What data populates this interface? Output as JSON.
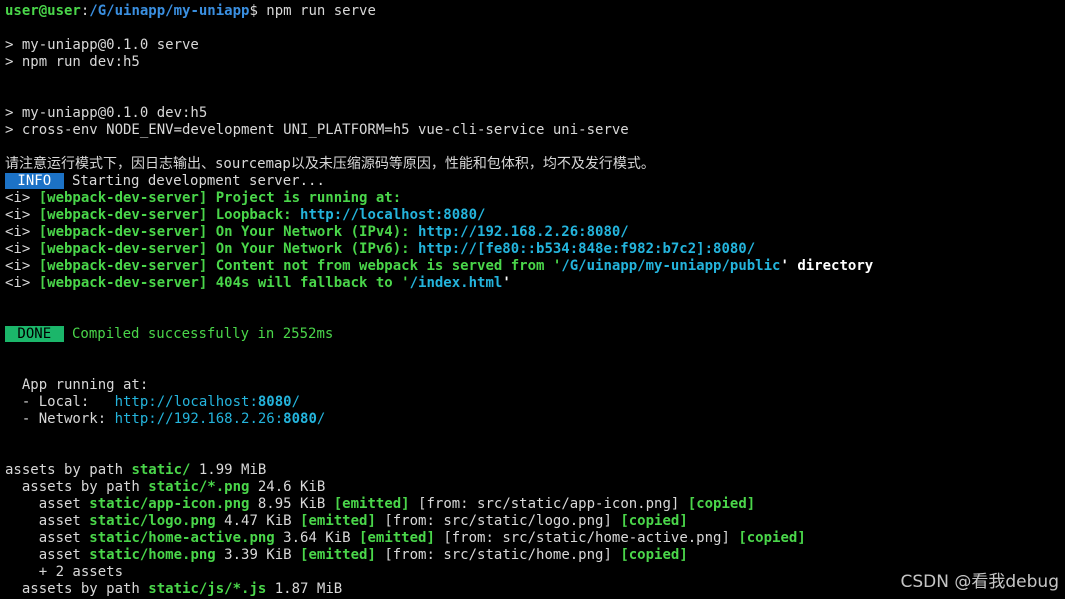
{
  "terminal": {
    "lines": [
      [
        {
          "t": "user@user",
          "c": "gb"
        },
        {
          "t": ":",
          "c": "w"
        },
        {
          "t": "/G/uinapp/my-uniapp",
          "c": "bb"
        },
        {
          "t": "$ npm run serve",
          "c": "w"
        }
      ],
      [],
      [
        {
          "t": "> my-uniapp@0.1.0 serve",
          "c": "w"
        }
      ],
      [
        {
          "t": "> npm run dev:h5",
          "c": "w"
        }
      ],
      [],
      [],
      [
        {
          "t": "> my-uniapp@0.1.0 dev:h5",
          "c": "w"
        }
      ],
      [
        {
          "t": "> cross-env NODE_ENV=development UNI_PLATFORM=h5 vue-cli-service uni-serve",
          "c": "w"
        }
      ],
      [],
      [
        {
          "t": "请注意运行模式下，因日志输出、sourcemap以及未压缩源码等原因，性能和包体积，均不及发行模式。",
          "c": "w"
        }
      ],
      [
        {
          "t": " INFO ",
          "c": "badge-info"
        },
        {
          "t": " Starting development server...",
          "c": "w"
        }
      ],
      [
        {
          "t": "<i> ",
          "c": "w"
        },
        {
          "t": "[webpack-dev-server] Project is running at:",
          "c": "gb"
        }
      ],
      [
        {
          "t": "<i> ",
          "c": "w"
        },
        {
          "t": "[webpack-dev-server] Loopback: ",
          "c": "gb"
        },
        {
          "t": "http://localhost:8080/",
          "c": "cb"
        }
      ],
      [
        {
          "t": "<i> ",
          "c": "w"
        },
        {
          "t": "[webpack-dev-server] On Your Network (IPv4): ",
          "c": "gb"
        },
        {
          "t": "http://192.168.2.26:8080/",
          "c": "cb"
        }
      ],
      [
        {
          "t": "<i> ",
          "c": "w"
        },
        {
          "t": "[webpack-dev-server] On Your Network (IPv6): ",
          "c": "gb"
        },
        {
          "t": "http://[fe80::b534:848e:f982:b7c2]:8080/",
          "c": "cb"
        }
      ],
      [
        {
          "t": "<i> ",
          "c": "w"
        },
        {
          "t": "[webpack-dev-server] Content not from webpack is served from '",
          "c": "gb"
        },
        {
          "t": "/G/uinapp/my-uniapp/public",
          "c": "cb"
        },
        {
          "t": "' directory",
          "c": "wb"
        }
      ],
      [
        {
          "t": "<i> ",
          "c": "w"
        },
        {
          "t": "[webpack-dev-server] 404s will fallback to '",
          "c": "gb"
        },
        {
          "t": "/index.html",
          "c": "cb"
        },
        {
          "t": "'",
          "c": "wb"
        }
      ],
      [],
      [],
      [
        {
          "t": " DONE ",
          "c": "badge-done"
        },
        {
          "t": " Compiled successfully in 2552ms",
          "c": "g"
        }
      ],
      [],
      [],
      [
        {
          "t": "  App running at:",
          "c": "w"
        }
      ],
      [
        {
          "t": "  - Local:   ",
          "c": "w"
        },
        {
          "t": "http://localhost:",
          "c": "c"
        },
        {
          "t": "8080",
          "c": "cb"
        },
        {
          "t": "/",
          "c": "c"
        }
      ],
      [
        {
          "t": "  - Network: ",
          "c": "w"
        },
        {
          "t": "http://192.168.2.26:",
          "c": "c"
        },
        {
          "t": "8080",
          "c": "cb"
        },
        {
          "t": "/",
          "c": "c"
        }
      ],
      [],
      [],
      [
        {
          "t": "assets by path ",
          "c": "w"
        },
        {
          "t": "static/",
          "c": "gb"
        },
        {
          "t": " 1.99 MiB",
          "c": "w"
        }
      ],
      [
        {
          "t": "  assets by path ",
          "c": "w"
        },
        {
          "t": "static/*.png",
          "c": "gb"
        },
        {
          "t": " 24.6 KiB",
          "c": "w"
        }
      ],
      [
        {
          "t": "    asset ",
          "c": "w"
        },
        {
          "t": "static/app-icon.png",
          "c": "gb"
        },
        {
          "t": " 8.95 KiB ",
          "c": "w"
        },
        {
          "t": "[emitted]",
          "c": "gb"
        },
        {
          "t": " [from: src/static/app-icon.png] ",
          "c": "w"
        },
        {
          "t": "[copied]",
          "c": "gb"
        }
      ],
      [
        {
          "t": "    asset ",
          "c": "w"
        },
        {
          "t": "static/logo.png",
          "c": "gb"
        },
        {
          "t": " 4.47 KiB ",
          "c": "w"
        },
        {
          "t": "[emitted]",
          "c": "gb"
        },
        {
          "t": " [from: src/static/logo.png] ",
          "c": "w"
        },
        {
          "t": "[copied]",
          "c": "gb"
        }
      ],
      [
        {
          "t": "    asset ",
          "c": "w"
        },
        {
          "t": "static/home-active.png",
          "c": "gb"
        },
        {
          "t": " 3.64 KiB ",
          "c": "w"
        },
        {
          "t": "[emitted]",
          "c": "gb"
        },
        {
          "t": " [from: src/static/home-active.png] ",
          "c": "w"
        },
        {
          "t": "[copied]",
          "c": "gb"
        }
      ],
      [
        {
          "t": "    asset ",
          "c": "w"
        },
        {
          "t": "static/home.png",
          "c": "gb"
        },
        {
          "t": " 3.39 KiB ",
          "c": "w"
        },
        {
          "t": "[emitted]",
          "c": "gb"
        },
        {
          "t": " [from: src/static/home.png] ",
          "c": "w"
        },
        {
          "t": "[copied]",
          "c": "gb"
        }
      ],
      [
        {
          "t": "    + 2 assets",
          "c": "w"
        }
      ],
      [
        {
          "t": "  assets by path ",
          "c": "w"
        },
        {
          "t": "static/js/*.js",
          "c": "gb"
        },
        {
          "t": " 1.87 MiB",
          "c": "w"
        }
      ]
    ]
  },
  "watermark": "CSDN @看我debug",
  "colors": {
    "background": "#000000",
    "prompt_user": "#4ad64a",
    "prompt_path": "#3a8fe0",
    "link": "#24b4dc",
    "info_badge": "#1c72c6",
    "done_badge": "#1bb66a"
  }
}
